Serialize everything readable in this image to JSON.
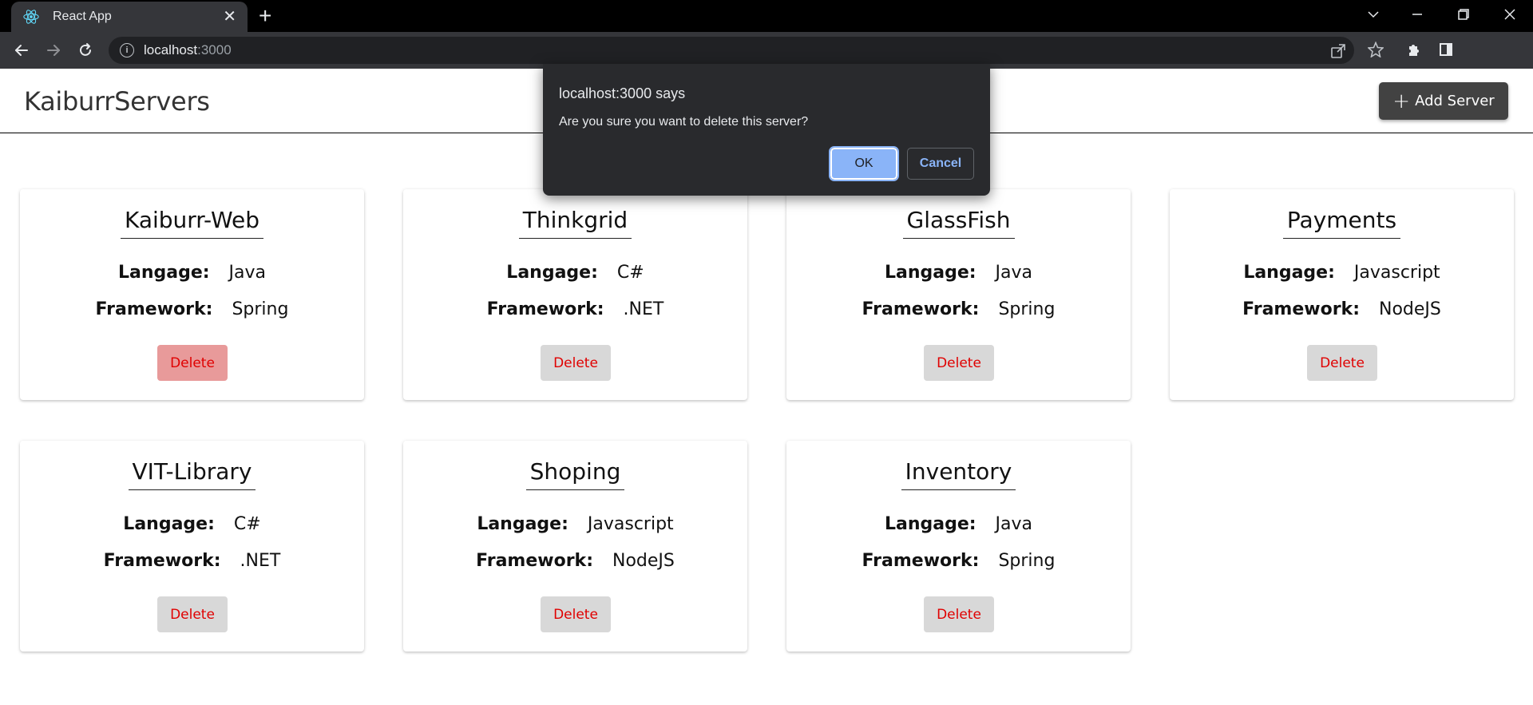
{
  "browser": {
    "tab_title": "React App",
    "url_host": "localhost",
    "url_port": ":3000"
  },
  "app": {
    "brand": "KaiburrServers",
    "add_button_label": "Add Server",
    "field_language_label": "Langage:",
    "field_framework_label": "Framework:",
    "delete_label": "Delete"
  },
  "servers": [
    {
      "name": "Kaiburr-Web",
      "language": "Java",
      "framework": "Spring",
      "delete_active": true
    },
    {
      "name": "Thinkgrid",
      "language": "C#",
      "framework": ".NET",
      "delete_active": false
    },
    {
      "name": "GlassFish",
      "language": "Java",
      "framework": "Spring",
      "delete_active": false
    },
    {
      "name": "Payments",
      "language": "Javascript",
      "framework": "NodeJS",
      "delete_active": false
    },
    {
      "name": "VIT-Library",
      "language": "C#",
      "framework": ".NET",
      "delete_active": false
    },
    {
      "name": "Shoping",
      "language": "Javascript",
      "framework": "NodeJS",
      "delete_active": false
    },
    {
      "name": "Inventory",
      "language": "Java",
      "framework": "Spring",
      "delete_active": false
    }
  ],
  "dialog": {
    "title": "localhost:3000 says",
    "message": "Are you sure you want to delete this server?",
    "ok_label": "OK",
    "cancel_label": "Cancel"
  },
  "colors": {
    "delete_text": "#e00000",
    "dialog_accent": "#8ab4f8"
  }
}
